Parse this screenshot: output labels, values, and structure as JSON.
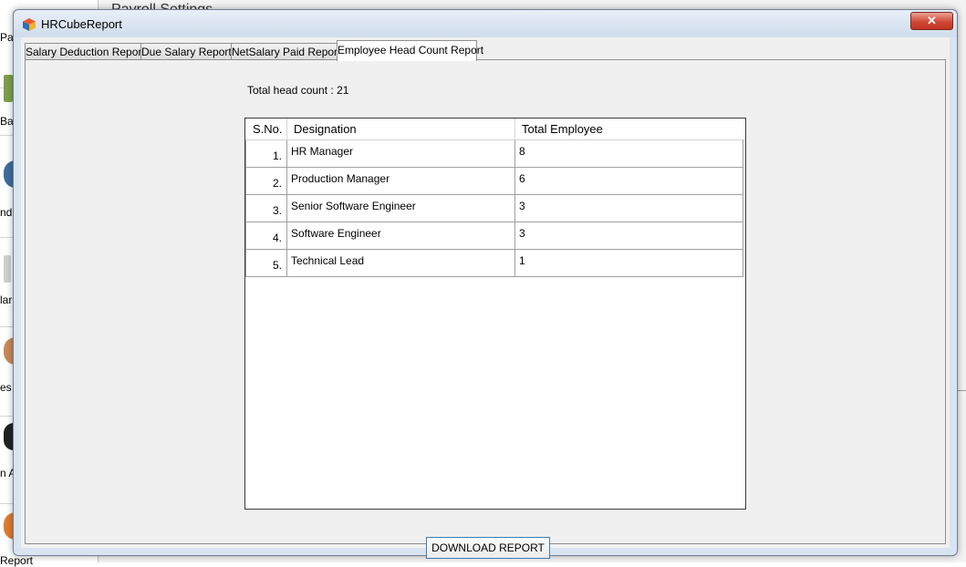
{
  "background": {
    "title": "Payroll Settings",
    "sidebar_labels": [
      "Pay",
      "Ban",
      "nda",
      "lar",
      "es",
      "n A",
      "Report"
    ]
  },
  "window": {
    "title": "HRCubeReport",
    "close_symbol": "✕"
  },
  "tabs": [
    {
      "label": "Salary Deduction Report"
    },
    {
      "label": "Due Salary Report"
    },
    {
      "label": "NetSalary Paid Report"
    },
    {
      "label": "Employee Head Count Report",
      "active": true
    }
  ],
  "report": {
    "head_count_label": "Total head count : 21",
    "columns": [
      "S.No.",
      "Designation",
      "Total Employee"
    ],
    "rows": [
      {
        "sno": "1.",
        "designation": "HR Manager",
        "total": "8"
      },
      {
        "sno": "2.",
        "designation": "Production Manager",
        "total": "6"
      },
      {
        "sno": "3.",
        "designation": "Senior Software Engineer",
        "total": "3"
      },
      {
        "sno": "4.",
        "designation": "Software Engineer",
        "total": "3"
      },
      {
        "sno": "5.",
        "designation": "Technical Lead",
        "total": "1"
      }
    ],
    "download_label": "DOWNLOAD REPORT"
  },
  "colors": {
    "close_button": "#c13421",
    "button_border": "#3c7fb1",
    "window_frame": "#d9e4f1"
  }
}
